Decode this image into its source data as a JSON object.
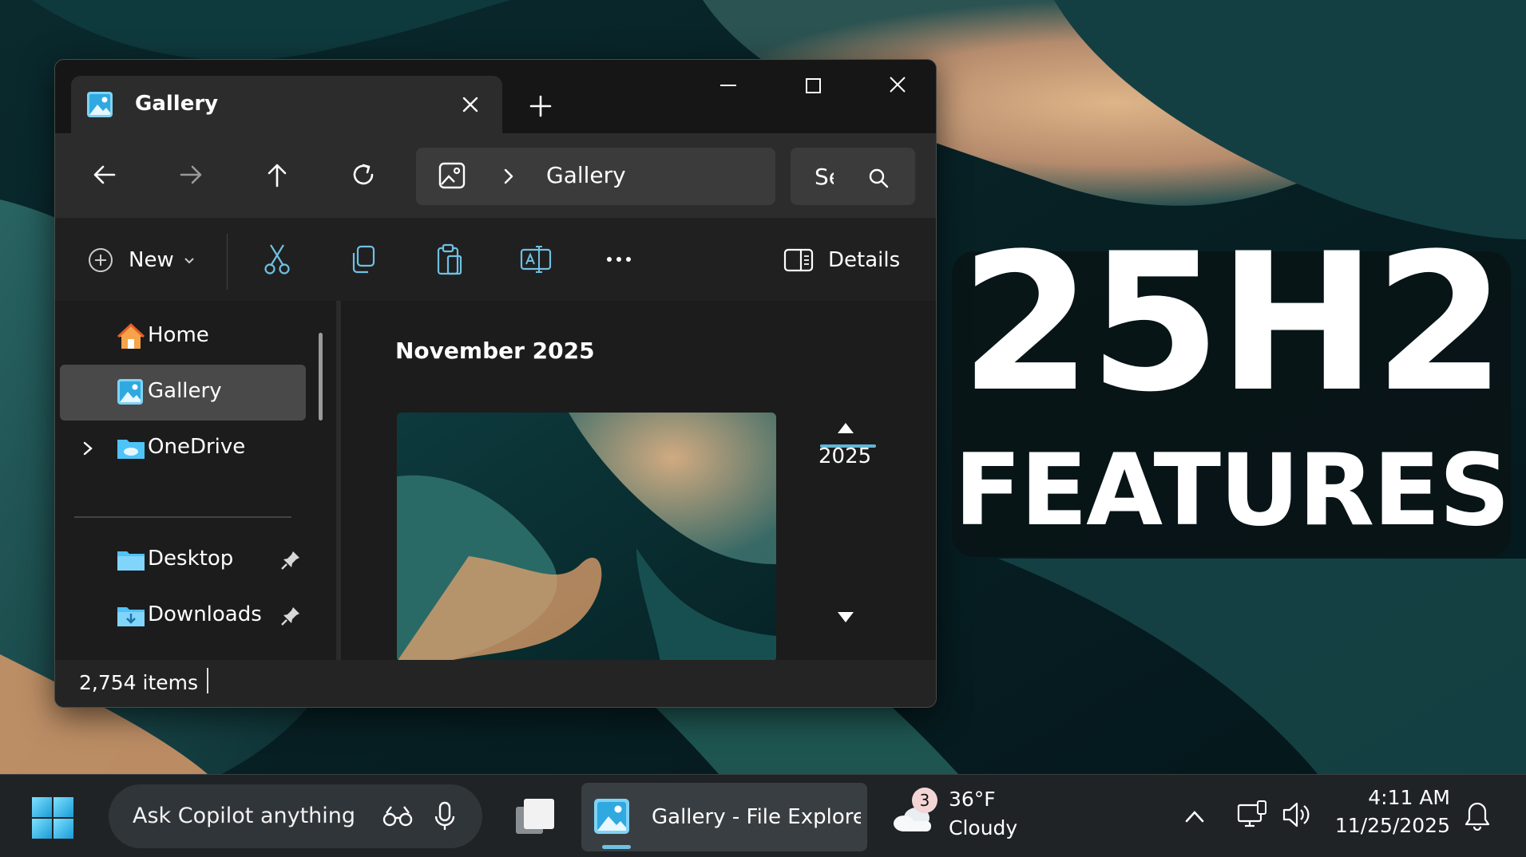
{
  "window": {
    "tab_title": "Gallery",
    "address_current": "Gallery",
    "search_placeholder": "Search Gallery",
    "commands": {
      "new_label": "New",
      "details_label": "Details"
    },
    "sidebar": {
      "items": [
        {
          "label": "Home",
          "icon": "home-icon"
        },
        {
          "label": "Gallery",
          "icon": "gallery-icon",
          "selected": true
        },
        {
          "label": "OneDrive",
          "icon": "cloud-folder-icon"
        },
        {
          "label": "Desktop",
          "icon": "folder-icon",
          "pinned": true
        },
        {
          "label": "Downloads",
          "icon": "downloads-folder-icon",
          "pinned": true
        }
      ]
    },
    "content": {
      "group_title": "November 2025",
      "timeline_year": "2025"
    },
    "status": {
      "item_count": "2,754 items"
    }
  },
  "banner": {
    "line1": "25H2",
    "line2": "FEATURES"
  },
  "taskbar": {
    "copilot_placeholder": "Ask Copilot anything",
    "app_label": "Gallery - File Explorer",
    "weather": {
      "badge": "3",
      "temp": "36°F",
      "condition": "Cloudy"
    },
    "clock": {
      "time": "4:11 AM",
      "date": "11/25/2025"
    }
  },
  "colors": {
    "accent": "#6fc1e3",
    "window_bg": "#202020",
    "taskbar_bg": "#1f2326"
  }
}
